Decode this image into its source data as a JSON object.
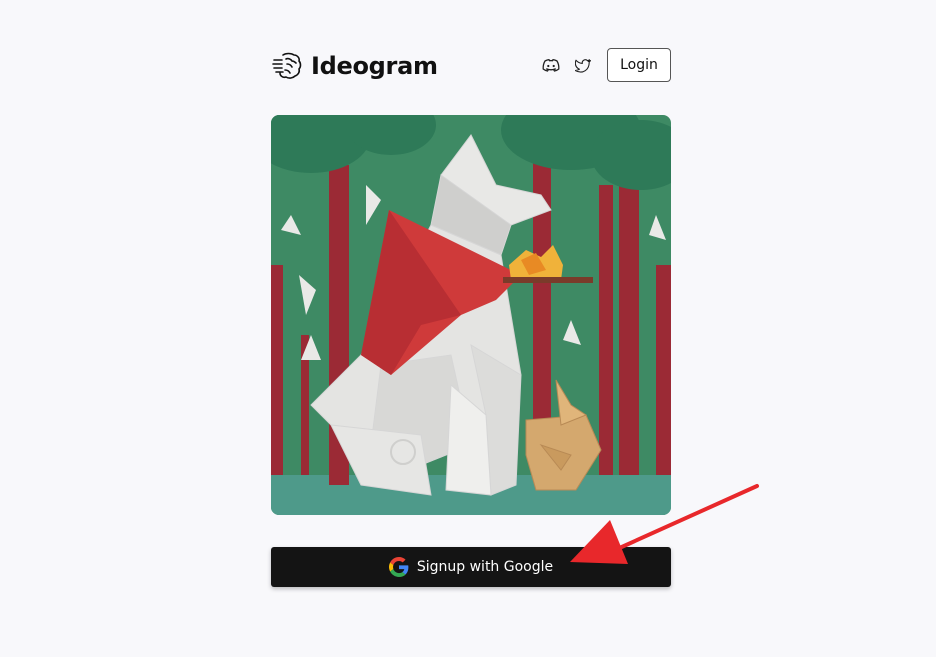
{
  "brand": {
    "name": "Ideogram",
    "logo_icon": "brain-icon"
  },
  "header": {
    "social": [
      {
        "name": "discord-icon",
        "label": "Discord"
      },
      {
        "name": "twitter-icon",
        "label": "Twitter"
      }
    ],
    "login_label": "Login"
  },
  "hero": {
    "subject": "papercraft wolf in a forest"
  },
  "signup": {
    "label": "Signup with Google",
    "icon": "google-icon"
  },
  "annotation": {
    "icon": "red-arrow-icon",
    "color": "#e8282b"
  },
  "colors": {
    "background": "#f8f8fb",
    "button_dark": "#141414",
    "forest_green": "#3e8a64",
    "trunk_red": "#9b2a35"
  }
}
